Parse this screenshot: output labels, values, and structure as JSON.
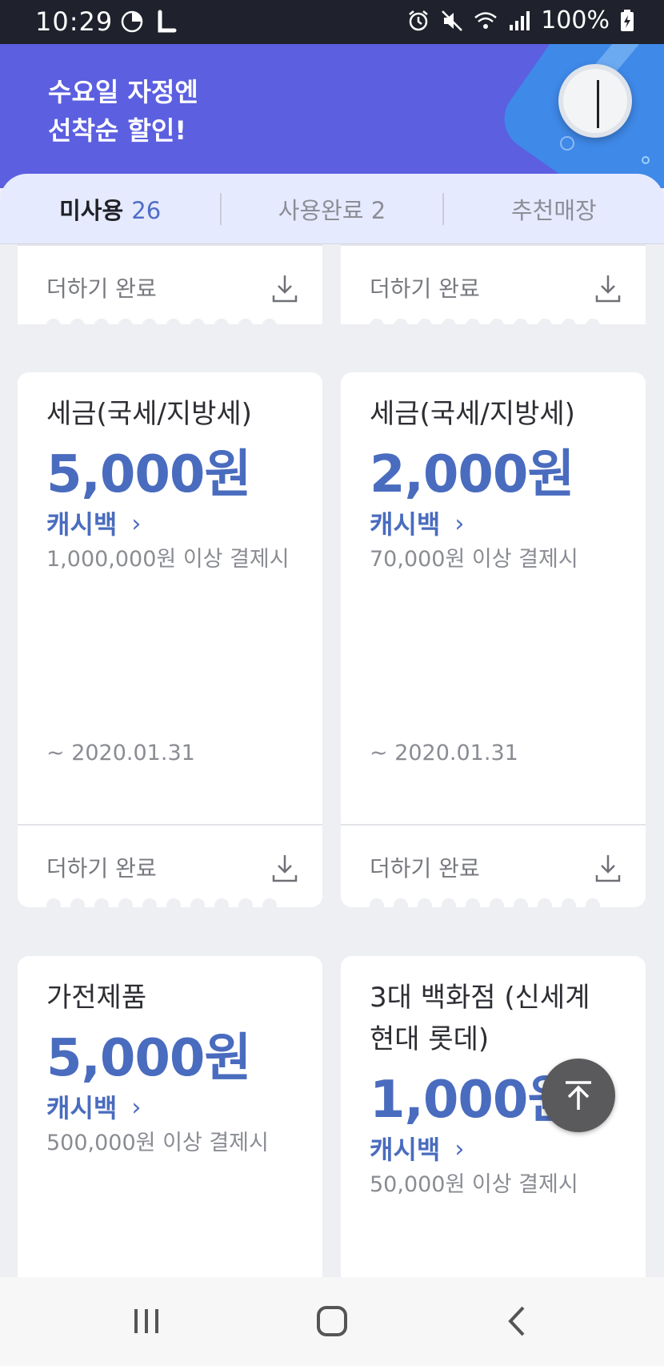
{
  "status_bar": {
    "time": "10:29",
    "battery": "100%",
    "left_icons": [
      "pie-chart-icon",
      "l-app-icon"
    ],
    "right_icons": [
      "alarm-icon",
      "mute-icon",
      "wifi-icon",
      "signal-icon",
      "battery-charging-icon"
    ]
  },
  "banner": {
    "line1": "수요일 자정엔",
    "line2": "선착순 할인!",
    "colors": {
      "background": "#5b5fe0",
      "accent": "#3f89e8"
    }
  },
  "tabs": [
    {
      "label": "미사용",
      "count": "26",
      "active": true
    },
    {
      "label": "사용완료 2",
      "active": false
    },
    {
      "label": "추천매장",
      "active": false
    }
  ],
  "partial_cards": {
    "left": {
      "footer": "더하기 완료"
    },
    "right": {
      "footer": "더하기 완료"
    }
  },
  "cards": [
    {
      "title": "세금(국세/지방세)",
      "amount": "5,000원",
      "cashback": "캐시백",
      "condition": "1,000,000원 이상 결제시",
      "expiry": "~ 2020.01.31",
      "footer": "더하기 완료"
    },
    {
      "title": "세금(국세/지방세)",
      "amount": "2,000원",
      "cashback": "캐시백",
      "condition": "70,000원 이상 결제시",
      "expiry": "~ 2020.01.31",
      "footer": "더하기 완료"
    },
    {
      "title": "가전제품",
      "amount": "5,000원",
      "cashback": "캐시백",
      "condition": "500,000원 이상 결제시"
    },
    {
      "title_line1": "3대 백화점 (신세계",
      "title_line2": "현대 롯데)",
      "amount": "1,000원",
      "cashback": "캐시백",
      "condition": "50,000원 이상 결제시"
    }
  ],
  "colors": {
    "accent_blue": "#4a6cbf",
    "scroll_top_button": "#5a5a5c"
  },
  "nav": [
    "recent-apps-icon",
    "home-icon",
    "back-icon"
  ]
}
